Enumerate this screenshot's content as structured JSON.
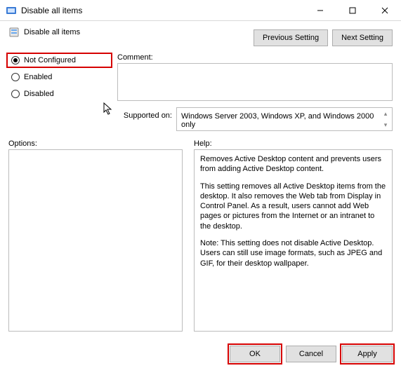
{
  "window": {
    "title": "Disable all items",
    "subtitle": "Disable all items"
  },
  "nav": {
    "prev": "Previous Setting",
    "next": "Next Setting"
  },
  "options": {
    "not_configured": "Not Configured",
    "enabled": "Enabled",
    "disabled": "Disabled",
    "selected": "not_configured"
  },
  "labels": {
    "comment": "Comment:",
    "supported": "Supported on:",
    "options": "Options:",
    "help": "Help:"
  },
  "supported_text": "Windows Server 2003, Windows XP, and Windows 2000 only",
  "help": {
    "p1": "Removes Active Desktop content and prevents users from adding Active Desktop content.",
    "p2": "This setting removes all Active Desktop items from the desktop. It also removes the Web tab from Display in Control Panel. As a result, users cannot add Web pages or  pictures from the Internet or an intranet to the desktop.",
    "p3": "Note: This setting does not disable Active Desktop. Users can  still use image formats, such as JPEG and GIF, for their desktop wallpaper."
  },
  "footer": {
    "ok": "OK",
    "cancel": "Cancel",
    "apply": "Apply"
  }
}
